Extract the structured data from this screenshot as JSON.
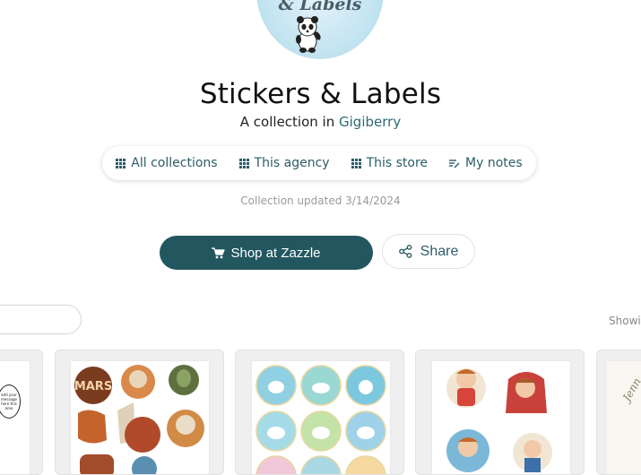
{
  "avatar": {
    "text": "& Labels"
  },
  "collection": {
    "title": "Stickers & Labels",
    "subtitle_prefix": "A collection in",
    "store_name": "Gigiberry",
    "updated": "Collection updated 3/14/2024"
  },
  "nav": {
    "items": [
      {
        "label": "All collections",
        "icon": "grid-icon"
      },
      {
        "label": "This agency",
        "icon": "grid-icon"
      },
      {
        "label": "This store",
        "icon": "grid-icon"
      },
      {
        "label": "My notes",
        "icon": "notes-icon"
      }
    ]
  },
  "actions": {
    "shop_label": "Shop at Zazzle",
    "share_label": "Share"
  },
  "results": {
    "showing_text": "Showi"
  },
  "products": [
    {
      "name": "speech-bubble-stickers",
      "speech_text": "add your message here this area"
    },
    {
      "name": "mars-stickers",
      "sticker_text": "MARS"
    },
    {
      "name": "unicorn-stickers"
    },
    {
      "name": "boy-astronaut-stickers"
    },
    {
      "name": "name-label",
      "label_text": "Jenn"
    }
  ],
  "colors": {
    "accent": "#23575f",
    "link": "#2c6a74",
    "muted": "#9a9a9a"
  }
}
